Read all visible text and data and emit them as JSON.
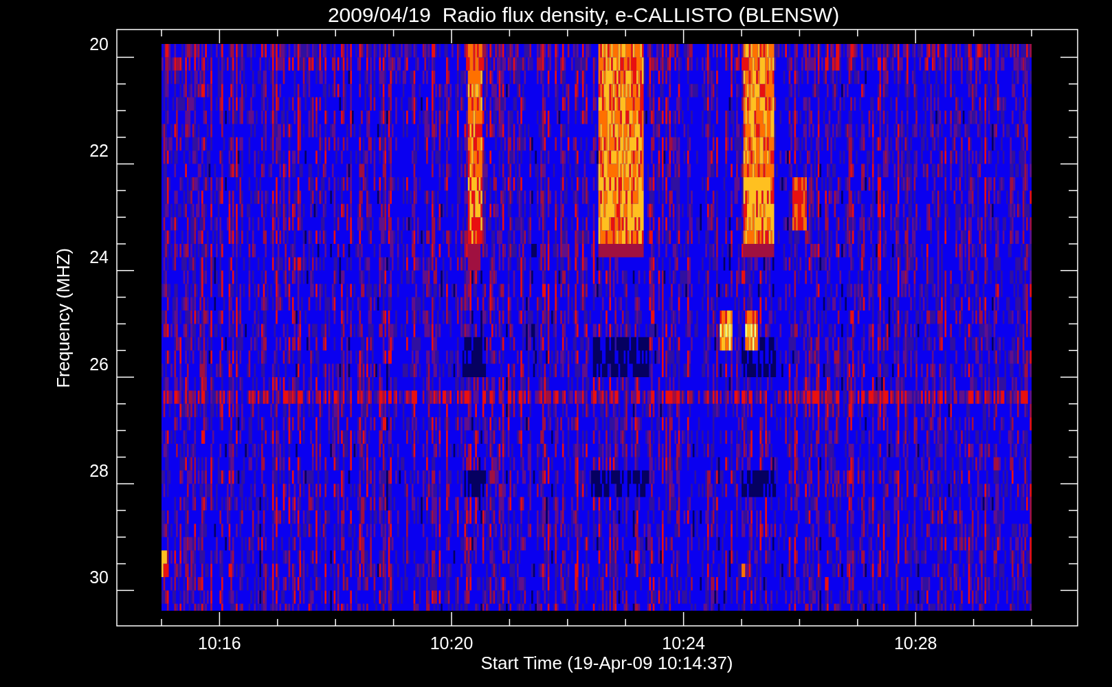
{
  "title": "2009/04/19  Radio flux density, e-CALLISTO (BLENSW)",
  "y_axis": {
    "label": "Frequency (MHZ)",
    "ticks": [
      "20",
      "22",
      "24",
      "26",
      "28",
      "30"
    ]
  },
  "x_axis": {
    "label": "Start Time (19-Apr-09 10:14:37)",
    "ticks": [
      "10:16",
      "10:20",
      "10:24",
      "10:28"
    ]
  }
}
